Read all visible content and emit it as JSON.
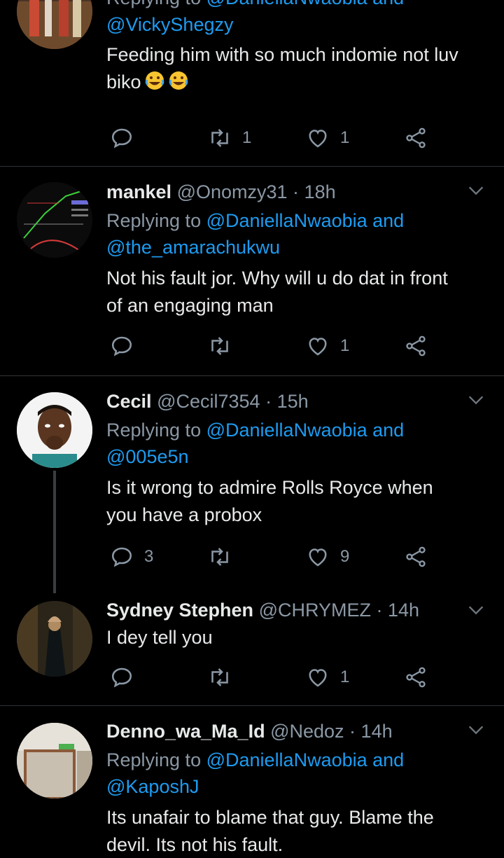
{
  "tweets": [
    {
      "replying_prefix": "Replying to",
      "mention_1": "@DaniellaNwaobia and",
      "mention_2": "@VickyShegzy",
      "text": "Feeding him with so much indomie not luv biko",
      "emoji": [
        "rolling-on-floor-laughing",
        "rolling-on-floor-laughing"
      ],
      "replies": "",
      "retweets": "1",
      "likes": "1"
    },
    {
      "name": "mankel",
      "handle": "@Onomzy31",
      "sep": " · ",
      "time": "18h",
      "replying_prefix": "Replying to",
      "mention_1": "@DaniellaNwaobia and",
      "mention_2": "@the_amarachukwu",
      "text_line1": "Not his fault jor. Why will u do dat in front",
      "text_line2": "of an engaging man",
      "replies": "",
      "retweets": "",
      "likes": "1"
    },
    {
      "name": "Cecil",
      "handle": "@Cecil7354",
      "sep": " · ",
      "time": "15h",
      "replying_prefix": "Replying to",
      "mention_1": "@DaniellaNwaobia and",
      "mention_2": "@005e5n",
      "text_line1": "Is it wrong to admire Rolls Royce when",
      "text_line2": "you have a probox",
      "replies": "3",
      "retweets": "",
      "likes": "9"
    },
    {
      "name": "Sydney Stephen",
      "handle": "@CHRYMEZ",
      "sep": " · ",
      "time": "14h",
      "text": "I dey tell you",
      "replies": "",
      "retweets": "",
      "likes": "1"
    },
    {
      "name": "Denno_wa_Ma_Id",
      "handle": "@Nedoz",
      "sep": " · ",
      "time": "14h",
      "replying_prefix": "Replying to",
      "mention_1": "@DaniellaNwaobia and",
      "mention_2": "@KaposhJ",
      "text_line1": "Its unafair to blame that guy. Blame the",
      "text_line2": "devil. Its not his fault."
    }
  ],
  "colors": {
    "background": "#000000",
    "text": "#e7e9ea",
    "secondary": "#8b98a5",
    "link": "#1d9bf0",
    "divider": "#2f3336"
  },
  "icons": [
    "reply-icon",
    "retweet-icon",
    "like-icon",
    "share-icon",
    "chevron-down-icon"
  ]
}
